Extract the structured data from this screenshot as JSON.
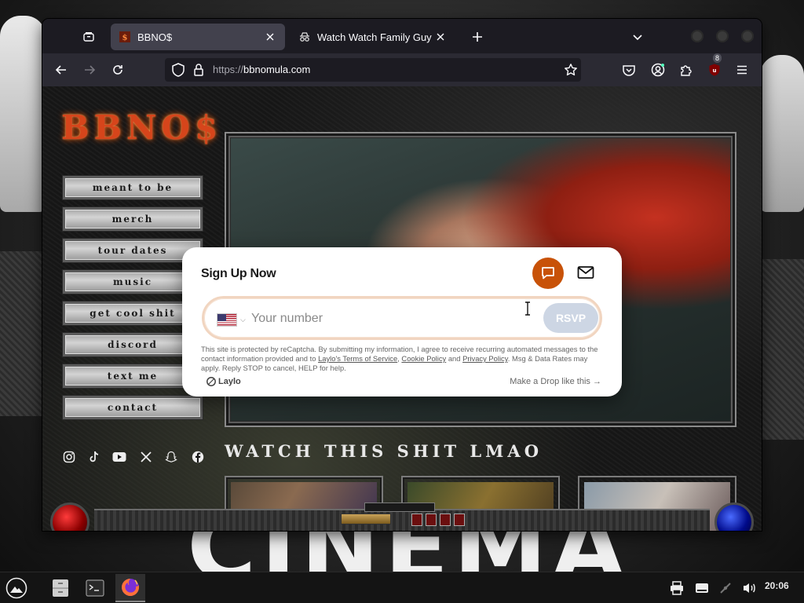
{
  "browser": {
    "tabs": [
      {
        "title": "BBNO$",
        "active": true,
        "favicon": "bbno-favicon"
      },
      {
        "title": "Watch Watch Family Guy Online",
        "active": false,
        "favicon": "incognito-favicon"
      }
    ],
    "url_protocol": "https://",
    "url_host": "bbnomula.com",
    "ublock_badge": "8"
  },
  "site": {
    "logo": "BBNO$",
    "nav": [
      {
        "label": "meant to be"
      },
      {
        "label": "merch"
      },
      {
        "label": "tour dates"
      },
      {
        "label": "music"
      },
      {
        "label": "get cool shit"
      },
      {
        "label": "discord"
      },
      {
        "label": "text me"
      },
      {
        "label": "contact"
      }
    ],
    "social_icons": [
      "instagram-icon",
      "tiktok-icon",
      "youtube-icon",
      "x-icon",
      "snapchat-icon",
      "facebook-icon"
    ],
    "watch_heading": "WATCH THIS SHIT LMAO"
  },
  "signup": {
    "title": "Sign Up Now",
    "phone_placeholder": "Your number",
    "country": "US",
    "rsvp_label": "RSVP",
    "legal_prefix": "This site is protected by reCaptcha. By submitting my information, I agree to receive recurring automated messages to the contact information provided and to ",
    "legal_terms": "Laylo's Terms of Service",
    "legal_sep1": ", ",
    "legal_cookie": "Cookie Policy",
    "legal_and": " and ",
    "legal_privacy": "Privacy Policy",
    "legal_suffix": ". Msg & Data Rates may apply. Reply STOP to cancel, HELP for help.",
    "brand": "Laylo",
    "drop_link": "Make a Drop like this"
  },
  "taskbar": {
    "clock": "20:06"
  },
  "colors": {
    "modal_accent": "#c85208",
    "rsvp_disabled": "#cdd6e4",
    "logo": "#d6451b"
  }
}
